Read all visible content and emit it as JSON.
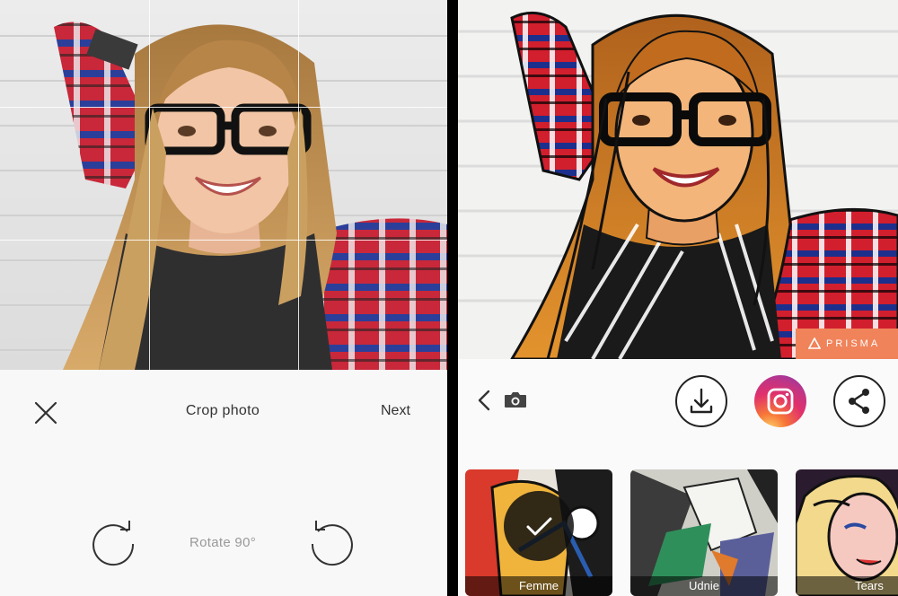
{
  "crop_screen": {
    "title": "Crop photo",
    "next_label": "Next",
    "rotate_label": "Rotate 90°",
    "icons": [
      "close-icon",
      "rotate-clockwise-icon",
      "rotate-counterclockwise-icon"
    ]
  },
  "share_screen": {
    "watermark": "PRISMA",
    "icons": [
      "back-icon",
      "camera-icon",
      "download-icon",
      "instagram-icon",
      "share-icon"
    ],
    "filters": [
      {
        "name": "Femme",
        "selected": true
      },
      {
        "name": "Udnie",
        "selected": false
      },
      {
        "name": "Tears",
        "selected": false
      }
    ]
  },
  "colors": {
    "watermark_bg": "#f0835a",
    "panel_bg": "#f8f8f8",
    "icon_stroke": "#222222"
  }
}
